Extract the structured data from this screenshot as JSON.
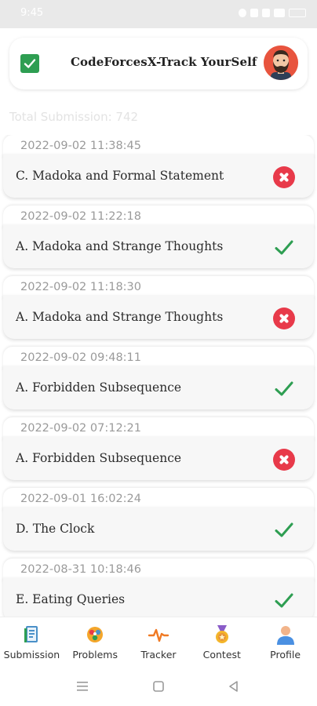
{
  "status_bar": {
    "time": "9:45"
  },
  "header": {
    "title": "CodeForcesX-Track YourSelf",
    "check_icon": "checkbox-icon",
    "avatar": "avatar"
  },
  "total_submission": "Total Submission: 742",
  "colors": {
    "accepted": "#2e9e52",
    "rejected": "#e83a4a",
    "title_check": "#2e9e52"
  },
  "submissions": [
    {
      "date": "2022-09-02 11:38:45",
      "problem": "C. Madoka and Formal Statement",
      "verdict": "rejected"
    },
    {
      "date": "2022-09-02 11:22:18",
      "problem": "A. Madoka and Strange Thoughts",
      "verdict": "accepted"
    },
    {
      "date": "2022-09-02 11:18:30",
      "problem": "A. Madoka and Strange Thoughts",
      "verdict": "rejected"
    },
    {
      "date": "2022-09-02 09:48:11",
      "problem": "A. Forbidden Subsequence",
      "verdict": "accepted"
    },
    {
      "date": "2022-09-02 07:12:21",
      "problem": "A. Forbidden Subsequence",
      "verdict": "rejected"
    },
    {
      "date": "2022-09-01 16:02:24",
      "problem": "D. The Clock",
      "verdict": "accepted"
    },
    {
      "date": "2022-08-31 10:18:46",
      "problem": "E. Eating Queries",
      "verdict": "accepted"
    }
  ],
  "nav": [
    {
      "label": "Submission",
      "icon": "submission-icon"
    },
    {
      "label": "Problems",
      "icon": "problems-icon"
    },
    {
      "label": "Tracker",
      "icon": "tracker-icon"
    },
    {
      "label": "Contest",
      "icon": "contest-icon"
    },
    {
      "label": "Profile",
      "icon": "profile-icon"
    }
  ]
}
